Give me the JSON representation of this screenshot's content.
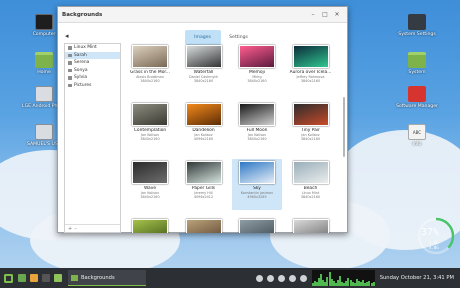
{
  "desktop": {
    "icons_left": [
      {
        "label": "Computer",
        "icon": "monitor-icon"
      },
      {
        "label": "Home",
        "icon": "folder-icon"
      },
      {
        "label": "LGE Android Phone",
        "icon": "phone-drive-icon"
      },
      {
        "label": "SAMUEL'S USB",
        "icon": "usb-drive-icon"
      }
    ],
    "icons_right": [
      {
        "label": "System Settings",
        "icon": "settings-icon"
      },
      {
        "label": "System",
        "icon": "folder-icon"
      },
      {
        "label": "Software Manager",
        "icon": "software-manager-icon"
      },
      {
        "label": "Info",
        "icon": "info-document-icon",
        "glyph": "ABC"
      }
    ]
  },
  "window": {
    "title": "Backgrounds",
    "controls": {
      "minimize": "–",
      "maximize": "□",
      "close": "✕"
    },
    "back": "◂",
    "tabs": [
      {
        "label": "Images",
        "active": true
      },
      {
        "label": "Settings",
        "active": false
      }
    ],
    "sidebar": {
      "items": [
        {
          "label": "Linux Mint",
          "selected": false
        },
        {
          "label": "Sarah",
          "selected": true
        },
        {
          "label": "Serena",
          "selected": false
        },
        {
          "label": "Sonya",
          "selected": false
        },
        {
          "label": "Sylvia",
          "selected": false
        },
        {
          "label": "Pictures",
          "selected": false
        }
      ],
      "add": "+",
      "remove": "–"
    },
    "images": [
      {
        "name": "Grass in the Mor...",
        "sub": "Alexis Brodtman",
        "size": "3840x2160",
        "colors": [
          "#ddd0bf",
          "#7a6a55"
        ]
      },
      {
        "name": "Waterfall",
        "sub": "Daniel Cashmyth",
        "size": "3840x2160",
        "colors": [
          "#d8dcde",
          "#343434"
        ]
      },
      {
        "name": "Memoji",
        "sub": "Mkirg",
        "size": "3840x2160",
        "colors": [
          "#ff5d8f",
          "#5a1a3e"
        ]
      },
      {
        "name": "Aurora over Icela...",
        "sub": "Jeffrey Rahmova",
        "size": "3840x2160",
        "colors": [
          "#0c2b3a",
          "#30c790"
        ]
      },
      {
        "name": "Contemplation",
        "sub": "Jan Kolisov",
        "size": "3840x2160",
        "colors": [
          "#8d8d80",
          "#3a3a32"
        ]
      },
      {
        "name": "Dandelion",
        "sub": "Jan Kolisov",
        "size": "4096x2160",
        "colors": [
          "#f28a1c",
          "#5c2c05"
        ]
      },
      {
        "name": "Full Moon",
        "sub": "Jan Kolisov",
        "size": "3840x2160",
        "colors": [
          "#191919",
          "#d0d0d0"
        ]
      },
      {
        "name": "Tiny Pair",
        "sub": "Jan Kolisov",
        "size": "3840x2160",
        "colors": [
          "#2c2c2c",
          "#c94a2a"
        ]
      },
      {
        "name": "Wave",
        "sub": "Jan Kolisov",
        "size": "3840x2160",
        "colors": [
          "#2b2b2b",
          "#6e6e6e"
        ]
      },
      {
        "name": "Paper Gills",
        "sub": "Jeremy Hill",
        "size": "4096x2412",
        "colors": [
          "#303838",
          "#d6e4de"
        ]
      },
      {
        "name": "Sky",
        "sub": "Konstantin Jasimov",
        "size": "4960x3265",
        "colors": [
          "#2f78c5",
          "#e6eef6"
        ],
        "selected": true
      },
      {
        "name": "Beach",
        "sub": "Linux Mint",
        "size": "3840x2160",
        "colors": [
          "#9aaeb9",
          "#eaeeee"
        ]
      },
      {
        "name": "",
        "sub": "",
        "size": "",
        "colors": [
          "#a6c24c",
          "#3f5a17"
        ]
      },
      {
        "name": "",
        "sub": "",
        "size": "",
        "colors": [
          "#bba27b",
          "#5c4630"
        ]
      },
      {
        "name": "",
        "sub": "",
        "size": "",
        "colors": [
          "#8f9da4",
          "#3d4a50"
        ]
      },
      {
        "name": "",
        "sub": "",
        "size": "",
        "colors": [
          "#d9d9d9",
          "#6b6b6b"
        ]
      }
    ]
  },
  "gauge": {
    "percent": "37%",
    "line1": "1.6G",
    "line2": "4.0G"
  },
  "taskbar": {
    "task_label": "Backgrounds",
    "clock": "Sunday October 21,  3:41 PM"
  }
}
